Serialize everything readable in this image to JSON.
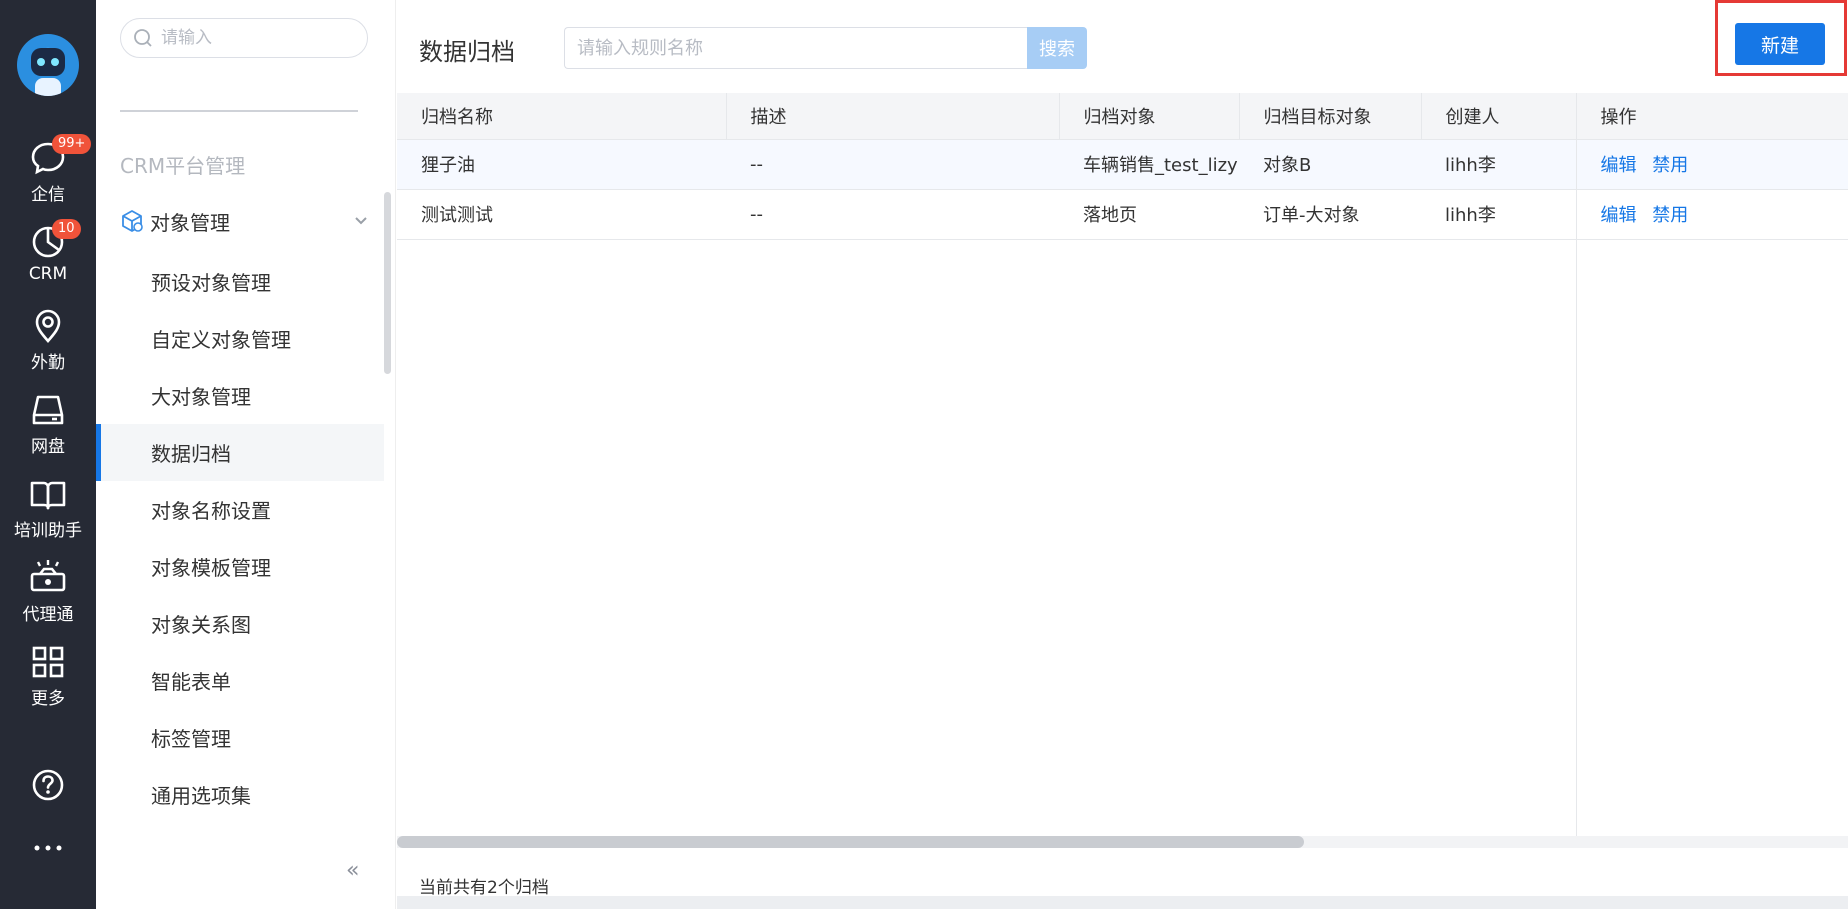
{
  "rail": {
    "items": [
      {
        "label": "企信",
        "icon": "chat-bubble-icon",
        "badge": "99+"
      },
      {
        "label": "CRM",
        "icon": "pie-chart-icon",
        "badge": "10"
      },
      {
        "label": "外勤",
        "icon": "location-pin-icon"
      },
      {
        "label": "网盘",
        "icon": "disk-drive-icon"
      },
      {
        "label": "培训助手",
        "icon": "open-book-icon"
      },
      {
        "label": "代理通",
        "icon": "agent-handshake-icon"
      },
      {
        "label": "更多",
        "icon": "grid-four-icon"
      }
    ],
    "help_icon": "help-circle-icon",
    "more_icon": "ellipsis-icon"
  },
  "menu": {
    "search_placeholder": "请输入",
    "group_title": "CRM平台管理",
    "parent": {
      "label": "对象管理",
      "icon": "object-cube-icon"
    },
    "items": [
      {
        "label": "预设对象管理"
      },
      {
        "label": "自定义对象管理"
      },
      {
        "label": "大对象管理"
      },
      {
        "label": "数据归档",
        "active": true
      },
      {
        "label": "对象名称设置"
      },
      {
        "label": "对象模板管理"
      },
      {
        "label": "对象关系图"
      },
      {
        "label": "智能表单"
      },
      {
        "label": "标签管理"
      },
      {
        "label": "通用选项集"
      }
    ],
    "collapse_glyph": "«"
  },
  "main": {
    "title": "数据归档",
    "search_placeholder": "请输入规则名称",
    "search_label": "搜索",
    "new_label": "新建",
    "columns": [
      "归档名称",
      "描述",
      "归档对象",
      "归档目标对象",
      "创建人",
      "操作"
    ],
    "rows": [
      {
        "name": "狸子油",
        "desc": "--",
        "object": "车辆销售_test_lizy",
        "target": "对象B",
        "creator": "lihh李",
        "edit": "编辑",
        "disable": "禁用"
      },
      {
        "name": "测试测试",
        "desc": "--",
        "object": "落地页",
        "target": "订单-大对象",
        "creator": "lihh李",
        "edit": "编辑",
        "disable": "禁用"
      }
    ],
    "footer": "当前共有2个归档"
  },
  "colors": {
    "rail_bg": "#262a35",
    "accent": "#1677e6",
    "badge": "#f0533a",
    "highlight_border": "#e53935"
  }
}
